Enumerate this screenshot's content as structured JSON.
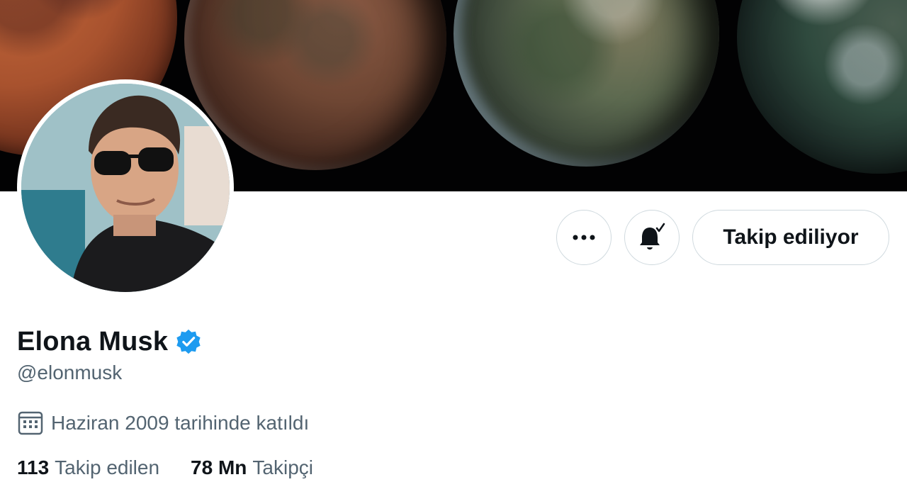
{
  "profile": {
    "display_name": "Elona Musk",
    "handle": "@elonmusk",
    "verified": true,
    "joined_text": "Haziran 2009 tarihinde katıldı"
  },
  "actions": {
    "more_icon": "more-horizontal-icon",
    "notify_icon": "bell-check-icon",
    "follow_label": "Takip ediliyor"
  },
  "stats": {
    "following_count": "113",
    "following_label": "Takip edilen",
    "followers_count": "78 Mn",
    "followers_label": "Takipçi"
  },
  "colors": {
    "verified_blue": "#1d9bf0",
    "text_primary": "#0f1419",
    "text_secondary": "#536471",
    "button_border": "#cfd9de"
  }
}
